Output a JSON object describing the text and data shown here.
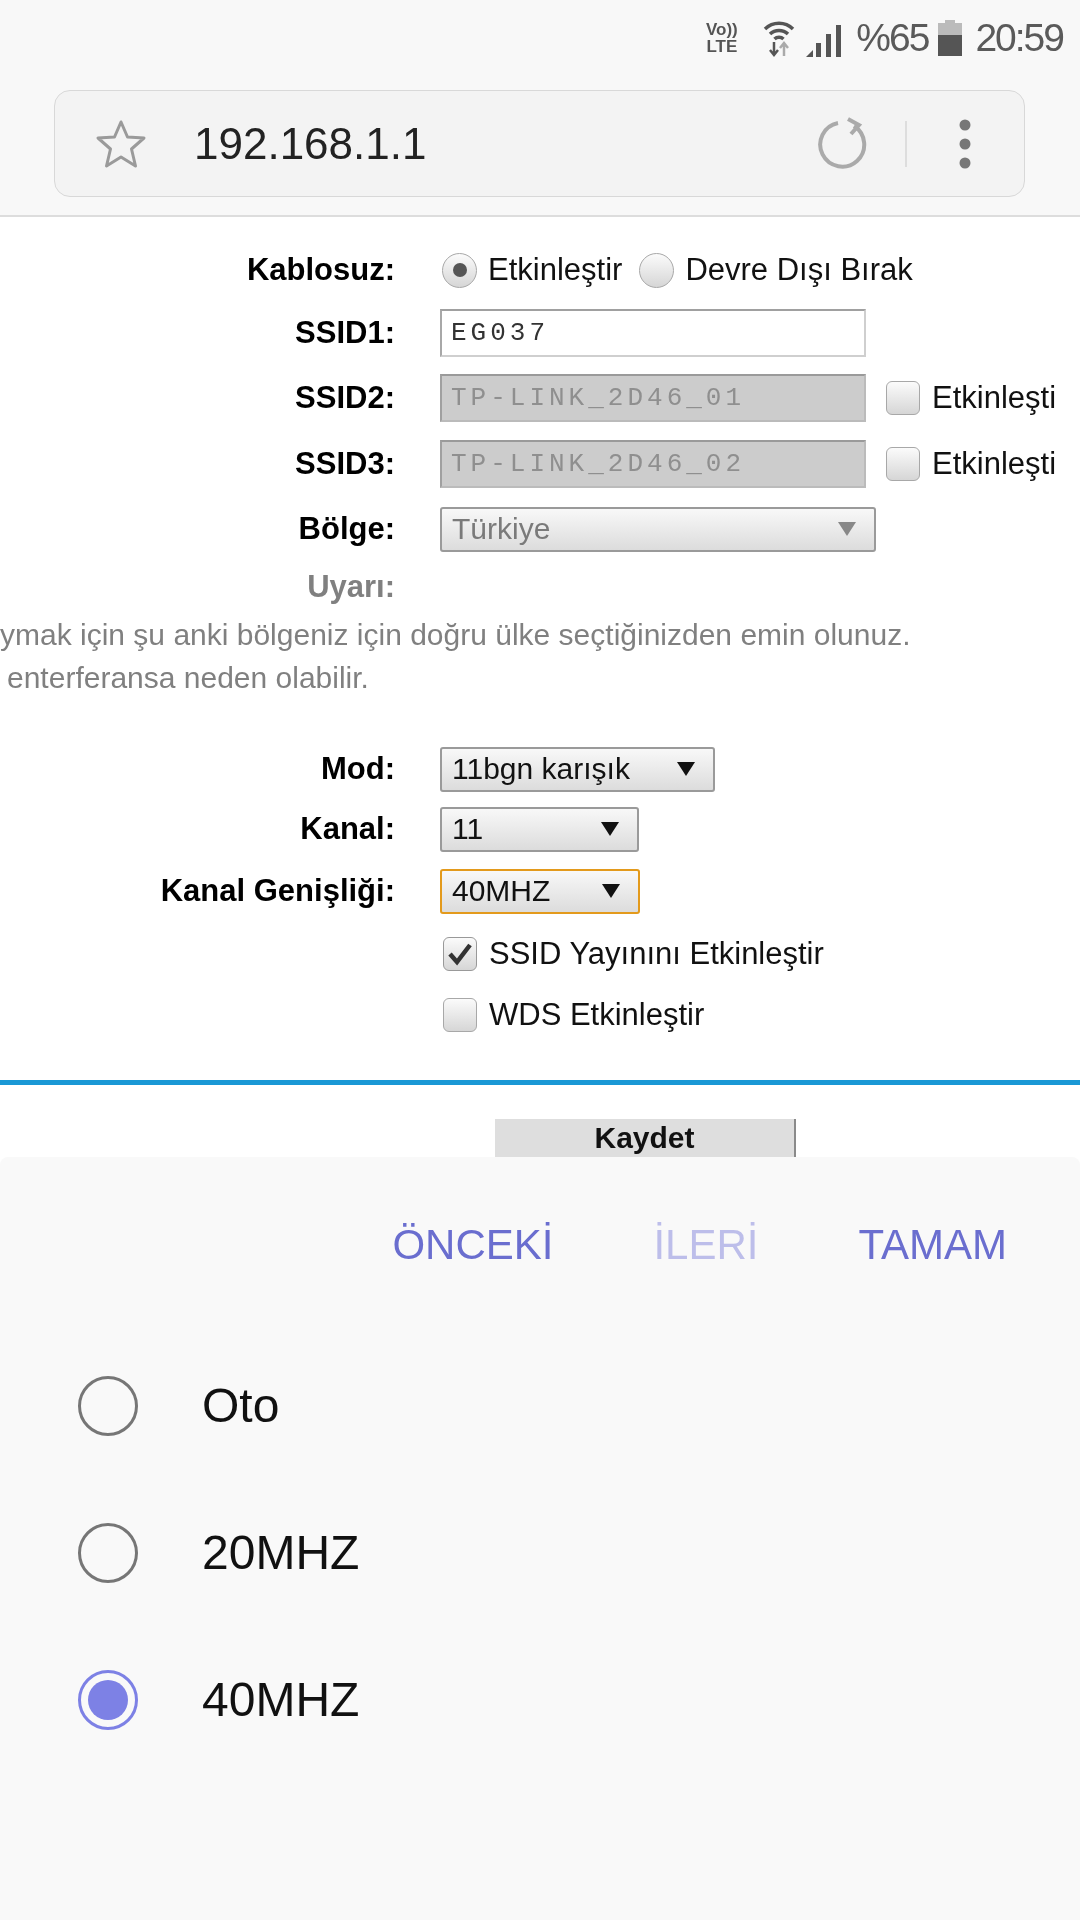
{
  "status_bar": {
    "network": [
      "Vo))",
      "LTE"
    ],
    "battery": "%65",
    "time": "20:59"
  },
  "address_bar": {
    "url": "192.168.1.1"
  },
  "form": {
    "wireless": {
      "label": "Kablosuz:",
      "options": [
        {
          "label": "Etkinleştir",
          "selected": true
        },
        {
          "label": "Devre Dışı Bırak",
          "selected": false
        }
      ]
    },
    "ssids": [
      {
        "label": "SSID1:",
        "value": "EG037",
        "disabled": false
      },
      {
        "label": "SSID2:",
        "value": "TP-LINK_2D46_01",
        "disabled": true,
        "enable": {
          "label": "Etkinleşti",
          "checked": false
        }
      },
      {
        "label": "SSID3:",
        "value": "TP-LINK_2D46_02",
        "disabled": true,
        "enable": {
          "label": "Etkinleşti",
          "checked": false
        }
      }
    ],
    "region": {
      "label": "Bölge:",
      "value": "Türkiye",
      "disabled": true
    },
    "warning": {
      "label": "Uyarı:",
      "lines": [
        "ymak için şu anki bölgeniz için doğru ülke seçtiğinizden emin olunuz.",
        "enterferansa neden olabilir."
      ]
    },
    "selects": [
      {
        "label": "Mod:",
        "value": "11bgn karışık",
        "focused": false
      },
      {
        "label": "Kanal:",
        "value": "11",
        "focused": false
      },
      {
        "label": "Kanal Genişliği:",
        "value": "40MHZ",
        "focused": true
      }
    ],
    "checkboxes": [
      {
        "label": "SSID Yayınını Etkinleştir",
        "checked": true
      },
      {
        "label": "WDS Etkinleştir",
        "checked": false
      }
    ],
    "save_button": "Kaydet"
  },
  "picker": {
    "actions": [
      {
        "label": "ÖNCEKİ",
        "disabled": false
      },
      {
        "label": "İLERİ",
        "disabled": true
      },
      {
        "label": "TAMAM",
        "disabled": false
      }
    ],
    "options": [
      {
        "label": "Oto",
        "selected": false
      },
      {
        "label": "20MHZ",
        "selected": false
      },
      {
        "label": "40MHZ",
        "selected": true
      }
    ]
  }
}
